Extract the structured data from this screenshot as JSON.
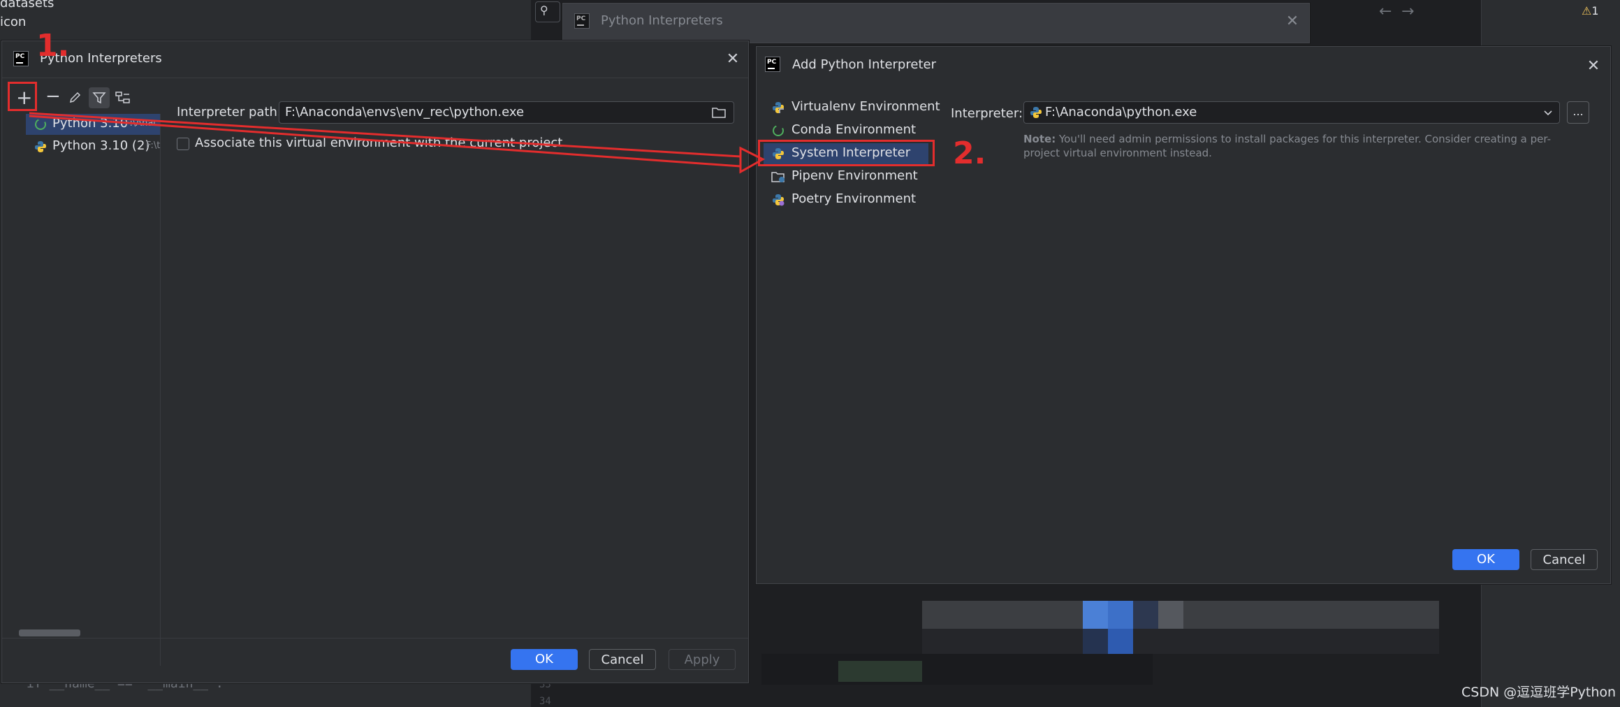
{
  "background": {
    "project_items": [
      "datasets",
      "icon"
    ],
    "code_line": "if __name__ == '__main__':",
    "warning_count": "1",
    "watermark": "CSDN @逗逗班学Python"
  },
  "bg_dialog": {
    "title": "Python Interpreters"
  },
  "main_dialog": {
    "title": "Python Interpreters",
    "interpreters": [
      {
        "name": "Python 3.10",
        "path": "F:\\Anac"
      },
      {
        "name": "Python 3.10 (2)",
        "path": "F:\\t"
      }
    ],
    "interpreter_path_label": "Interpreter path:",
    "interpreter_path_value": "F:\\Anaconda\\envs\\env_rec\\python.exe",
    "associate_label": "Associate this virtual environment with the current project",
    "ok": "OK",
    "cancel": "Cancel",
    "apply": "Apply"
  },
  "add_dialog": {
    "title": "Add Python Interpreter",
    "env_types": [
      {
        "label": "Virtualenv Environment",
        "icon": "virtualenv-icon"
      },
      {
        "label": "Conda Environment",
        "icon": "conda-icon"
      },
      {
        "label": "System Interpreter",
        "icon": "python-icon"
      },
      {
        "label": "Pipenv Environment",
        "icon": "pipenv-icon"
      },
      {
        "label": "Poetry Environment",
        "icon": "poetry-icon"
      }
    ],
    "selected_index": 2,
    "interpreter_label": "Interpreter:",
    "interpreter_value": "F:\\Anaconda\\python.exe",
    "browse": "...",
    "note_bold": "Note:",
    "note_text": "You'll need admin permissions to install packages for this interpreter. Consider creating a per-project virtual environment instead.",
    "ok": "OK",
    "cancel": "Cancel"
  },
  "annotations": {
    "step1": "1.",
    "step2": "2."
  },
  "colors": {
    "accent": "#3574f0",
    "annotation": "#e32d2d",
    "selection": "#2e436e"
  }
}
